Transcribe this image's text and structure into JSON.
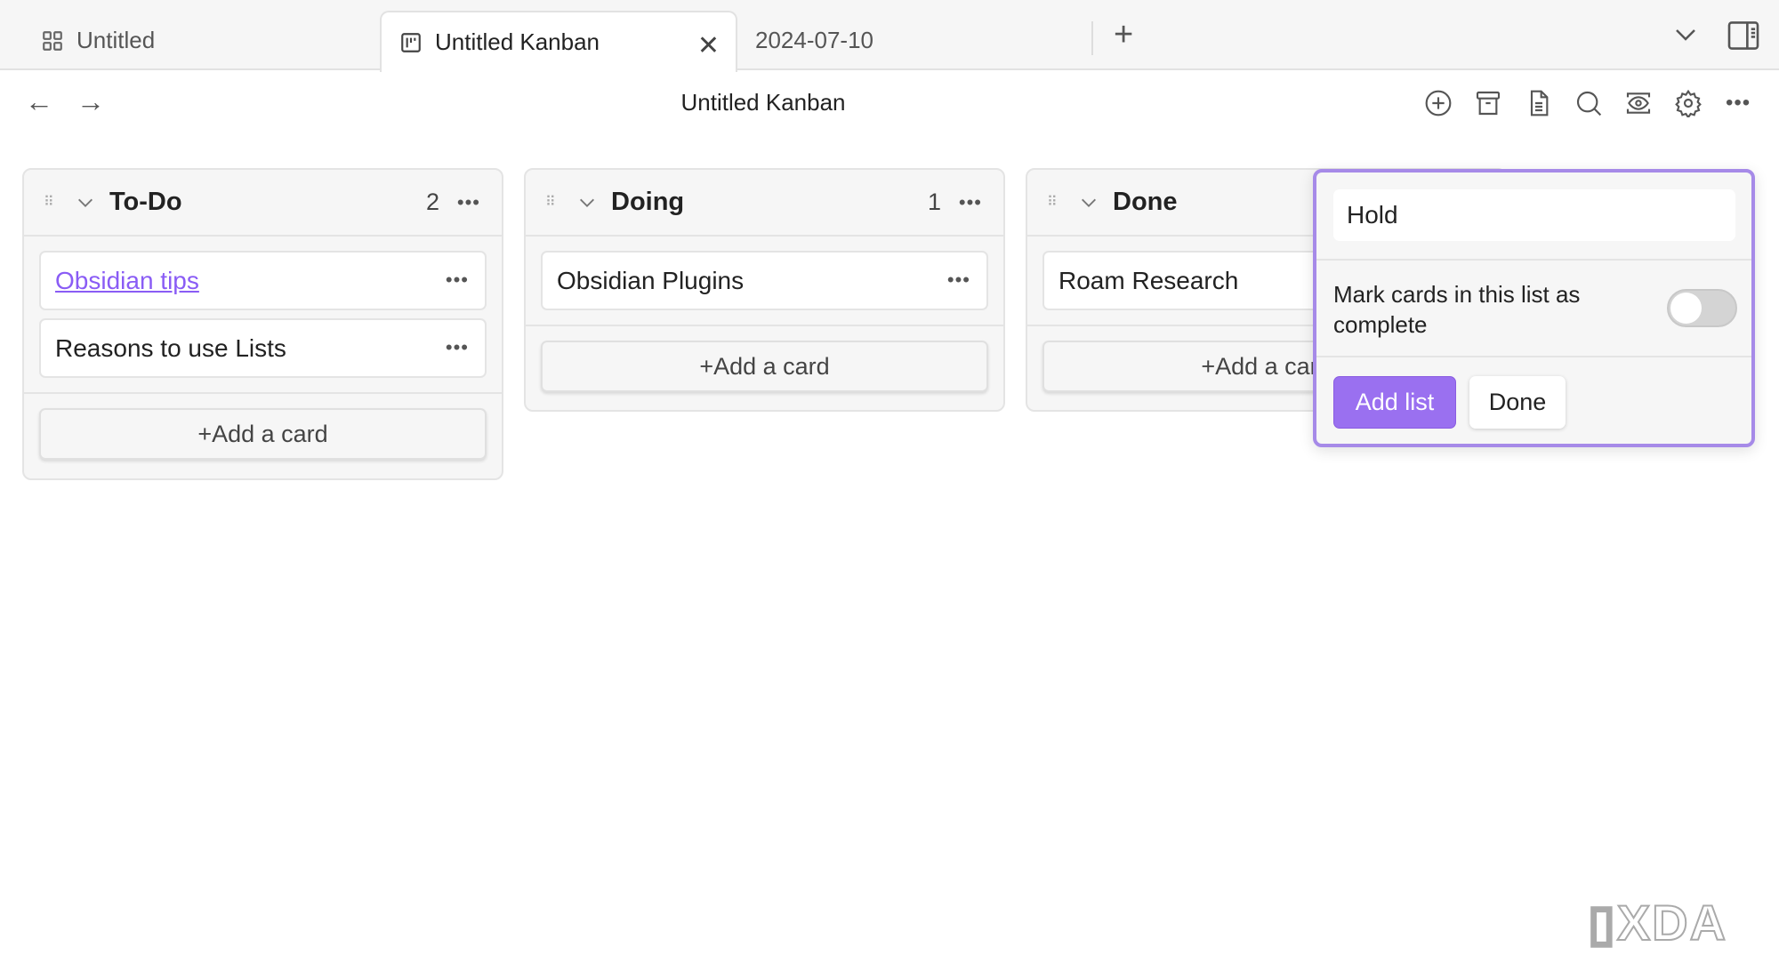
{
  "tabs": [
    {
      "label": "Untitled",
      "icon": "grid-icon"
    },
    {
      "label": "Untitled Kanban",
      "icon": "kanban-icon",
      "active": true
    },
    {
      "label": "2024-07-10"
    }
  ],
  "header": {
    "title": "Untitled Kanban",
    "icons": [
      "add-circle-icon",
      "archive-icon",
      "document-icon",
      "search-icon",
      "eye-icon",
      "gear-icon",
      "more-icon"
    ]
  },
  "lists": [
    {
      "name": "To-Do",
      "count": "2",
      "cards": [
        {
          "text": "Obsidian tips",
          "link": true
        },
        {
          "text": "Reasons to use Lists"
        }
      ],
      "add": "+Add a card"
    },
    {
      "name": "Doing",
      "count": "1",
      "cards": [
        {
          "text": "Obsidian Plugins"
        }
      ],
      "add": "+Add a card"
    },
    {
      "name": "Done",
      "cards": [
        {
          "text": "Roam Research"
        }
      ],
      "add": "+Add a card"
    }
  ],
  "popup": {
    "input_value": "Hold",
    "toggle_label": "Mark cards in this list as complete",
    "toggle_on": false,
    "add_label": "Add list",
    "done_label": "Done"
  },
  "colors": {
    "accent": "#9a70f0",
    "link": "#8a5cf5"
  },
  "watermark": "XDA"
}
